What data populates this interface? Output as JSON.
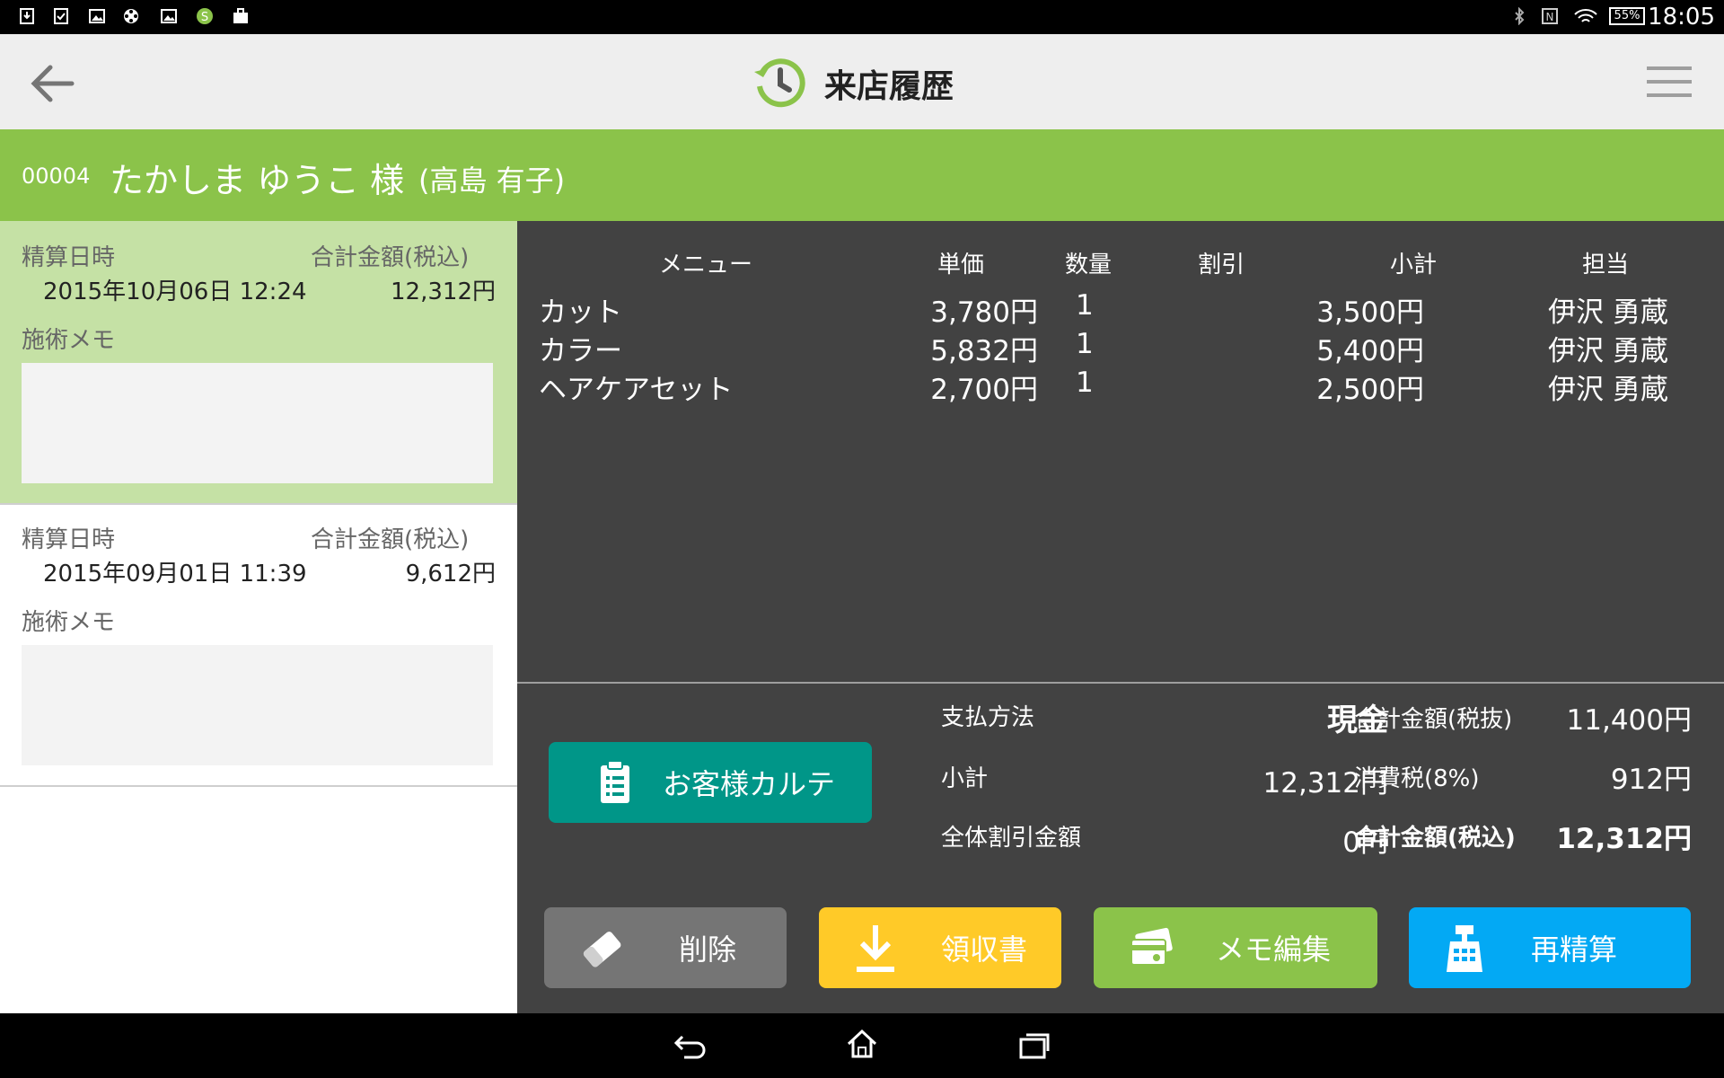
{
  "status_bar": {
    "time": "18:05",
    "battery": "55%"
  },
  "app_bar": {
    "title": "来店履歴"
  },
  "customer": {
    "id": "00004",
    "name": "たかしま ゆうこ 様",
    "kanji": "(高島 有子)"
  },
  "history": [
    {
      "date_label": "精算日時",
      "total_label": "合計金額(税込)",
      "date": "2015年10月06日 12:24",
      "total": "12,312円",
      "memo_label": "施術メモ"
    },
    {
      "date_label": "精算日時",
      "total_label": "合計金額(税込)",
      "date": "2015年09月01日 11:39",
      "total": "9,612円",
      "memo_label": "施術メモ"
    }
  ],
  "table": {
    "headers": {
      "menu": "メニュー",
      "unit": "単価",
      "qty": "数量",
      "discount": "割引",
      "subtotal": "小計",
      "staff": "担当"
    },
    "rows": [
      {
        "menu": "カット",
        "unit": "3,780円",
        "qty": "1",
        "discount": "",
        "subtotal": "3,500円",
        "staff": "伊沢 勇蔵"
      },
      {
        "menu": "カラー",
        "unit": "5,832円",
        "qty": "1",
        "discount": "",
        "subtotal": "5,400円",
        "staff": "伊沢 勇蔵"
      },
      {
        "menu": "ヘアケアセット",
        "unit": "2,700円",
        "qty": "1",
        "discount": "",
        "subtotal": "2,500円",
        "staff": "伊沢 勇蔵"
      }
    ]
  },
  "summary": {
    "payment_label": "支払方法",
    "payment_value": "現金",
    "subtotal_label": "小計",
    "subtotal_value": "12,312円",
    "discount_label": "全体割引金額",
    "discount_value": "0円",
    "pre_tax_label": "合計金額(税抜)",
    "pre_tax_value": "11,400円",
    "tax_label": "消費税(8%)",
    "tax_value": "912円",
    "total_label": "合計金額(税込)",
    "total_value": "12,312円"
  },
  "buttons": {
    "karte": "お客様カルテ",
    "delete": "削除",
    "receipt": "領収書",
    "memo_edit": "メモ編集",
    "recalc": "再精算"
  },
  "colors": {
    "accent_green": "#8bc34a",
    "selected_card": "#c5e1a5",
    "panel_dark": "#424242",
    "karte_teal": "#009688",
    "delete_gray": "#757575",
    "receipt_yellow": "#ffca28",
    "memo_green": "#8bc34a",
    "recalc_blue": "#03a9f4"
  },
  "icons": [
    "back-arrow-icon",
    "history-clock-icon",
    "menu-hamburger-icon",
    "clipboard-icon",
    "eraser-icon",
    "download-icon",
    "card-icon",
    "register-icon",
    "nav-back-icon",
    "nav-home-icon",
    "nav-recents-icon"
  ]
}
